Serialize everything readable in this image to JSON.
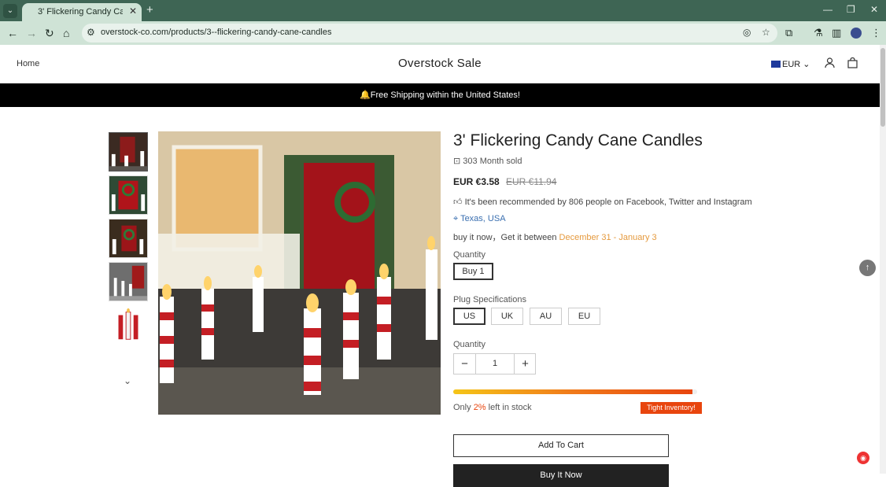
{
  "browser": {
    "tab_title": "3' Flickering Candy Cane Candles",
    "url": "overstock-co.com/products/3--flickering-candy-cane-candles"
  },
  "header": {
    "home": "Home",
    "logo": "Overstock Sale",
    "currency": "EUR"
  },
  "announcement": "🔔Free Shipping within the United States!",
  "product": {
    "title": "3' Flickering Candy Cane Candles",
    "sold": "303 Month sold",
    "price": "EUR €3.58",
    "old_price": "EUR €11.94",
    "recommendation": "It's been recommended by 806 people on Facebook, Twitter and Instagram",
    "location": "Texas, USA",
    "shipping_prefix": "buy it now，Get it between",
    "shipping_dates": "December 31 - January 3",
    "quantity_option_label": "Quantity",
    "quantity_options": [
      "Buy 1"
    ],
    "plug_label": "Plug Specifications",
    "plug_options": [
      "US",
      "UK",
      "AU",
      "EU"
    ],
    "plug_selected": "US",
    "quantity_label": "Quantity",
    "quantity_value": "1",
    "stock_prefix": "Only",
    "stock_percent": "2%",
    "stock_suffix": "left in stock",
    "stock_level": 0.98,
    "stock_badge": "Tight Inventory!",
    "add_to_cart": "Add To Cart",
    "buy_now": "Buy It Now"
  },
  "colors": {
    "chrome_tabbar": "#3e6554",
    "chrome_toolbar": "#cfe3d6",
    "accent_orange": "#e8450e",
    "link_blue": "#3a6fb0",
    "date_orange": "#e59a3e"
  }
}
